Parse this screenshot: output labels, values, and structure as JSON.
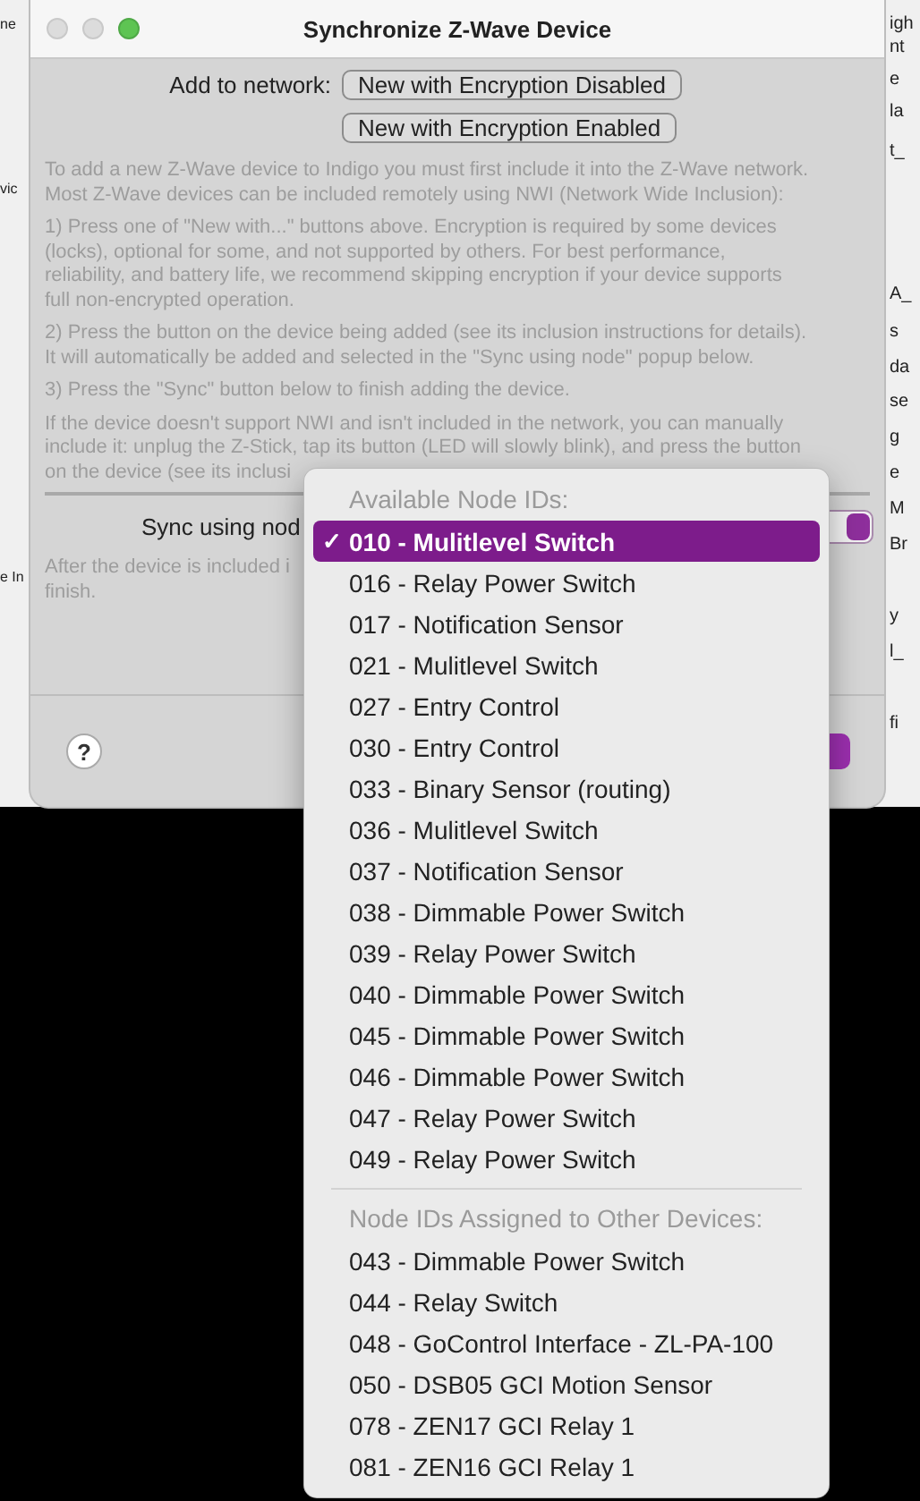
{
  "background_window": {
    "left_fragments": [
      "ne",
      "vic",
      "e In"
    ],
    "right_fragments": [
      "igh",
      "nt",
      "e",
      "la",
      "t_",
      "A_",
      "s",
      "da",
      "se",
      "g",
      "e",
      "M",
      "Br",
      "y",
      "l_",
      "fi"
    ]
  },
  "dialog": {
    "title": "Synchronize Z-Wave Device",
    "add_label": "Add to network:",
    "add_buttons": [
      "New with Encryption Disabled",
      "New with Encryption Enabled"
    ],
    "instructions": [
      {
        "lines": [
          "To add a new Z-Wave device to Indigo you must first include it into the Z-Wave network.",
          "Most Z-Wave devices can be included remotely using NWI (Network Wide Inclusion):"
        ]
      },
      {
        "lines": [
          "1) Press one of \"New with...\" buttons above. Encryption is required by some devices",
          "(locks), optional for some, and not supported by others. For best performance,",
          "reliability, and battery life, we recommend skipping encryption if your device supports",
          "full non-encrypted operation."
        ]
      },
      {
        "lines": [
          "2) Press the button on the device being added (see its inclusion instructions for details).",
          "It will automatically be added and selected in the \"Sync using node\" popup below."
        ]
      },
      {
        "lines": [
          "3) Press the \"Sync\" button below to finish adding the device."
        ]
      },
      {
        "lines": [
          "If the device doesn't support NWI and isn't included in the network, you can manually",
          "include it: unplug the Z-Stick, tap its button (LED will slowly blink), and press the button",
          "on the device (see its inclusi"
        ]
      }
    ],
    "sync_label": "Sync using nod",
    "after_note": {
      "lines": [
        "After the device is included i",
        "finish."
      ]
    },
    "help_button": "?"
  },
  "node_menu": {
    "check_mark": "✓",
    "sections": [
      {
        "heading": "Available Node IDs:",
        "items": [
          {
            "label": "010 - Mulitlevel Switch",
            "selected": true
          },
          {
            "label": "016 - Relay Power Switch",
            "selected": false
          },
          {
            "label": "017 - Notification Sensor",
            "selected": false
          },
          {
            "label": "021 - Mulitlevel Switch",
            "selected": false
          },
          {
            "label": "027 - Entry Control",
            "selected": false
          },
          {
            "label": "030 - Entry Control",
            "selected": false
          },
          {
            "label": "033 - Binary Sensor (routing)",
            "selected": false
          },
          {
            "label": "036 - Mulitlevel Switch",
            "selected": false
          },
          {
            "label": "037 - Notification Sensor",
            "selected": false
          },
          {
            "label": "038 - Dimmable Power Switch",
            "selected": false
          },
          {
            "label": "039 - Relay Power Switch",
            "selected": false
          },
          {
            "label": "040 - Dimmable Power Switch",
            "selected": false
          },
          {
            "label": "045 - Dimmable Power Switch",
            "selected": false
          },
          {
            "label": "046 - Dimmable Power Switch",
            "selected": false
          },
          {
            "label": "047 - Relay Power Switch",
            "selected": false
          },
          {
            "label": "049 - Relay Power Switch",
            "selected": false
          }
        ]
      },
      {
        "heading": "Node IDs Assigned to Other Devices:",
        "items": [
          {
            "label": "043 - Dimmable Power Switch",
            "selected": false
          },
          {
            "label": "044 - Relay Switch",
            "selected": false
          },
          {
            "label": "048 - GoControl Interface - ZL-PA-100",
            "selected": false
          },
          {
            "label": "050 - DSB05 GCI Motion Sensor",
            "selected": false
          },
          {
            "label": "078 - ZEN17 GCI Relay 1",
            "selected": false
          },
          {
            "label": "081 - ZEN16 GCI Relay 1",
            "selected": false
          }
        ]
      }
    ]
  }
}
